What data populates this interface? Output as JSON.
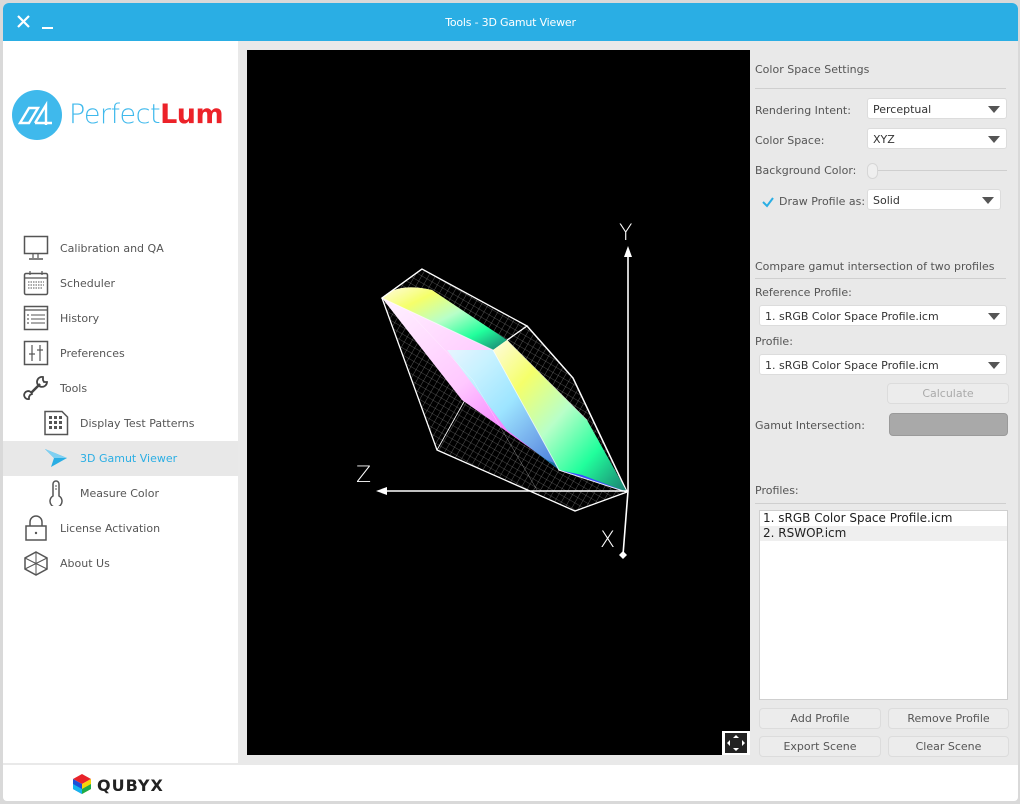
{
  "window": {
    "title": "Tools - 3D Gamut Viewer",
    "close_icon": "close-icon",
    "minimize_icon": "minimize-icon",
    "accent_color": "#2aaee4"
  },
  "logo": {
    "part1": "Perfect",
    "part2": "Lum",
    "part1_color": "#3fb9ec",
    "part2_color": "#ec2229"
  },
  "sidebar": {
    "items": [
      {
        "label": "Calibration and QA",
        "icon": "monitor-icon",
        "level": 1
      },
      {
        "label": "Scheduler",
        "icon": "calendar-icon",
        "level": 1
      },
      {
        "label": "History",
        "icon": "list-icon",
        "level": 1
      },
      {
        "label": "Preferences",
        "icon": "sliders-icon",
        "level": 1
      },
      {
        "label": "Tools",
        "icon": "wrench-icon",
        "level": 1
      },
      {
        "label": "Display Test Patterns",
        "icon": "grid-document-icon",
        "level": 2
      },
      {
        "label": "3D Gamut Viewer",
        "icon": "gamut-arrow-icon",
        "level": 2,
        "active": true
      },
      {
        "label": "Measure Color",
        "icon": "thermometer-icon",
        "level": 2
      },
      {
        "label": "License Activation",
        "icon": "lock-icon",
        "level": 1
      },
      {
        "label": "About Us",
        "icon": "cube-icon",
        "level": 1
      }
    ]
  },
  "viewer": {
    "axes": {
      "x": "X",
      "y": "Y",
      "z": "Z"
    },
    "fullscreen_icon": "fullscreen-icon"
  },
  "settings": {
    "section_title": "Color Space Settings",
    "rendering_intent_label": "Rendering Intent:",
    "rendering_intent_value": "Perceptual",
    "color_space_label": "Color Space:",
    "color_space_value": "XYZ",
    "background_color_label": "Background Color:",
    "background_color_level": 0,
    "draw_profile_label": "Draw Profile as:",
    "draw_profile_checked": true,
    "draw_profile_value": "Solid"
  },
  "compare": {
    "section_title": "Compare gamut intersection of two profiles",
    "reference_label": "Reference Profile:",
    "reference_value": "1. sRGB Color Space Profile.icm",
    "profile_label": "Profile:",
    "profile_value": "1. sRGB Color Space Profile.icm",
    "calculate_label": "Calculate",
    "gamut_intersection_label": "Gamut Intersection:"
  },
  "profiles": {
    "label": "Profiles:",
    "items": [
      "1. sRGB Color Space Profile.icm",
      "2. RSWOP.icm"
    ],
    "add_label": "Add Profile",
    "remove_label": "Remove Profile",
    "export_label": "Export Scene",
    "clear_label": "Clear Scene"
  },
  "footer": {
    "brand": "QUBYX"
  }
}
